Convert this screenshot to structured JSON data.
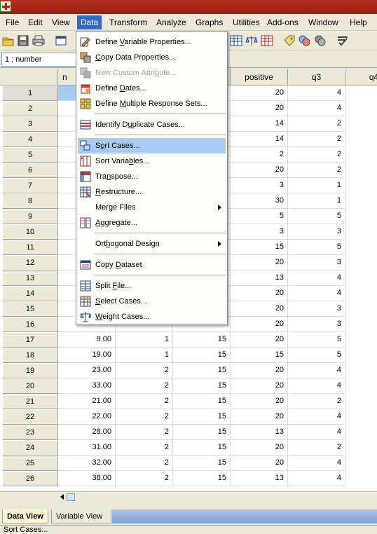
{
  "menubar": {
    "items": [
      "File",
      "Edit",
      "View",
      "Data",
      "Transform",
      "Analyze",
      "Graphs",
      "Utilities",
      "Add-ons",
      "Window",
      "Help"
    ]
  },
  "cellref": "1 : number",
  "grid": {
    "columns": [
      "n",
      "",
      "",
      "positive",
      "q3",
      "q4"
    ],
    "rows": [
      [
        "1",
        "",
        "",
        "",
        "20",
        "4"
      ],
      [
        "2",
        "",
        "",
        "",
        "20",
        "4"
      ],
      [
        "3",
        "",
        "",
        "",
        "14",
        "2"
      ],
      [
        "4",
        "",
        "",
        "",
        "14",
        "2"
      ],
      [
        "5",
        "",
        "",
        "",
        "2",
        "2"
      ],
      [
        "6",
        "",
        "",
        "",
        "20",
        "2"
      ],
      [
        "7",
        "",
        "",
        "",
        "3",
        "1"
      ],
      [
        "8",
        "",
        "",
        "",
        "30",
        "1"
      ],
      [
        "9",
        "",
        "",
        "",
        "5",
        "5"
      ],
      [
        "10",
        "",
        "",
        "",
        "3",
        "3"
      ],
      [
        "11",
        "",
        "",
        "",
        "15",
        "5"
      ],
      [
        "12",
        "",
        "",
        "",
        "20",
        "3"
      ],
      [
        "13",
        "",
        "",
        "",
        "13",
        "4"
      ],
      [
        "14",
        "",
        "",
        "",
        "20",
        "4"
      ],
      [
        "15",
        "",
        "",
        "",
        "20",
        "3"
      ],
      [
        "16",
        "",
        "",
        "",
        "20",
        "3"
      ],
      [
        "17",
        "9.00",
        "1",
        "15",
        "20",
        "5"
      ],
      [
        "18",
        "19.00",
        "1",
        "15",
        "15",
        "5"
      ],
      [
        "19",
        "23.00",
        "2",
        "15",
        "20",
        "4"
      ],
      [
        "20",
        "33.00",
        "2",
        "15",
        "20",
        "4"
      ],
      [
        "21",
        "21.00",
        "2",
        "15",
        "20",
        "2"
      ],
      [
        "22",
        "22.00",
        "2",
        "15",
        "20",
        "4"
      ],
      [
        "23",
        "28.00",
        "2",
        "15",
        "13",
        "4"
      ],
      [
        "24",
        "31.00",
        "2",
        "15",
        "20",
        "2"
      ],
      [
        "25",
        "32.00",
        "2",
        "15",
        "20",
        "4"
      ],
      [
        "26",
        "38.00",
        "2",
        "15",
        "13",
        "4"
      ]
    ]
  },
  "data_menu": {
    "items": [
      {
        "pre": "Define ",
        "u": "V",
        "post": "ariable Properties...",
        "icon": "variable-properties-icon"
      },
      {
        "pre": "",
        "u": "C",
        "post": "opy Data Properties...",
        "icon": "copy-properties-icon"
      },
      {
        "pre": "New Custom Attri",
        "u": "b",
        "post": "ute...",
        "icon": "custom-attribute-icon",
        "disabled": true
      },
      {
        "pre": "Define ",
        "u": "D",
        "post": "ates...",
        "icon": "define-dates-icon"
      },
      {
        "pre": "Define ",
        "u": "M",
        "post": "ultiple Response Sets...",
        "icon": "multiple-response-icon"
      },
      {
        "pre": "Identify D",
        "u": "u",
        "post": "plicate Cases...",
        "icon": "duplicate-cases-icon"
      },
      {
        "pre": "S",
        "u": "o",
        "post": "rt Cases...",
        "icon": "sort-cases-icon",
        "highlighted": true
      },
      {
        "pre": "Sort Varia",
        "u": "b",
        "post": "les...",
        "icon": "sort-variables-icon"
      },
      {
        "pre": "Tra",
        "u": "n",
        "post": "spose...",
        "icon": "transpose-icon"
      },
      {
        "pre": "",
        "u": "R",
        "post": "estructure...",
        "icon": "restructure-icon"
      },
      {
        "pre": "Mer",
        "u": "g",
        "post": "e Files",
        "submenu": true
      },
      {
        "pre": "",
        "u": "A",
        "post": "ggregate...",
        "icon": "aggregate-icon"
      },
      {
        "pre": "Ort",
        "u": "h",
        "post": "ogonal Design",
        "submenu": true
      },
      {
        "pre": "Copy ",
        "u": "D",
        "post": "ataset",
        "icon": "copy-dataset-icon"
      },
      {
        "pre": "Split ",
        "u": "F",
        "post": "ile...",
        "icon": "split-file-icon"
      },
      {
        "pre": "",
        "u": "S",
        "post": "elect Cases...",
        "icon": "select-cases-icon"
      },
      {
        "pre": "",
        "u": "W",
        "post": "eight Cases...",
        "icon": "weight-cases-icon"
      }
    ]
  },
  "tabs": {
    "data_view": "Data View",
    "variable_view": "Variable View"
  },
  "status": "Sort Cases..."
}
